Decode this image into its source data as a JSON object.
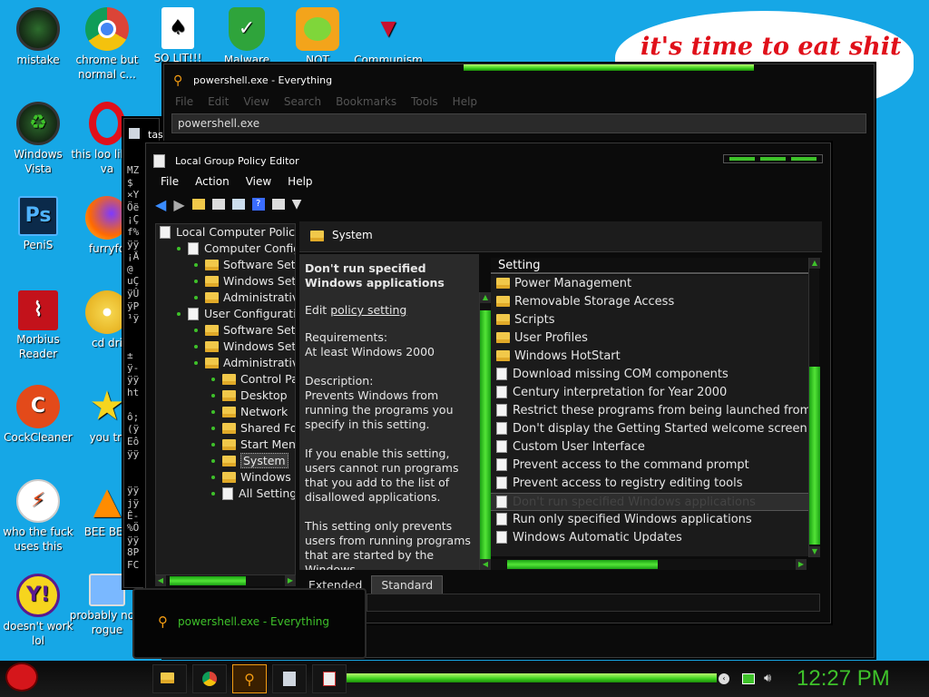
{
  "desktop_icons": [
    {
      "label": "mistake"
    },
    {
      "label": "chrome but normal c..."
    },
    {
      "label": "SO LIT!!!"
    },
    {
      "label": "Malware"
    },
    {
      "label": "NOT"
    },
    {
      "label": "Communism"
    },
    {
      "label": "Windows Vista"
    },
    {
      "label": "this loo like a va"
    },
    {
      "label": "PeniS"
    },
    {
      "label": "furryfo"
    },
    {
      "label": "Morbius Reader"
    },
    {
      "label": "cd dri"
    },
    {
      "label": "CockCleaner"
    },
    {
      "label": "you tri"
    },
    {
      "label": "who the fuck uses this"
    },
    {
      "label": "BEE BEE"
    },
    {
      "label": "doesn't work lol"
    },
    {
      "label": "probably no a rogue"
    }
  ],
  "bubble_text": "it's time to eat shit",
  "everything_window": {
    "title": "powershell.exe - Everything",
    "menu": [
      "File",
      "Edit",
      "View",
      "Search",
      "Bookmarks",
      "Tools",
      "Help"
    ],
    "search_value": "powershell.exe"
  },
  "terminal_window": {
    "title": "tas",
    "text_lines": [
      "MZ",
      "$",
      "×Y",
      "Öë",
      "¡Ç",
      "f%",
      "ÿÿ",
      "¡Ä",
      "@",
      "uÇ",
      "ÿÛ",
      "ÿP",
      "¹ÿ",
      "",
      "",
      "±",
      "ÿ-",
      "ÿÿ",
      "ht",
      "",
      "ô;",
      "(ÿ",
      "Eô",
      "ÿÿ",
      "",
      "",
      "ÿÿ",
      "jÿ",
      "Ê-",
      "%Ö",
      "ÿÿ",
      "8P",
      "FC"
    ]
  },
  "gpe": {
    "title": "Local Group Policy Editor",
    "menu": [
      "File",
      "Action",
      "View",
      "Help"
    ],
    "tree": [
      {
        "label": "Local Computer Policy",
        "indent": 0,
        "icon": "doc"
      },
      {
        "label": "Computer Configura",
        "indent": 1,
        "icon": "pc"
      },
      {
        "label": "Software Setting",
        "indent": 2,
        "icon": "folder"
      },
      {
        "label": "Windows Settin",
        "indent": 2,
        "icon": "folder"
      },
      {
        "label": "Administrative T",
        "indent": 2,
        "icon": "folder"
      },
      {
        "label": "User Configuration",
        "indent": 1,
        "icon": "pc"
      },
      {
        "label": "Software Setting",
        "indent": 2,
        "icon": "folder"
      },
      {
        "label": "Windows Settin",
        "indent": 2,
        "icon": "folder"
      },
      {
        "label": "Administrative T",
        "indent": 2,
        "icon": "folder"
      },
      {
        "label": "Control Pane",
        "indent": 3,
        "icon": "folder"
      },
      {
        "label": "Desktop",
        "indent": 3,
        "icon": "folder"
      },
      {
        "label": "Network",
        "indent": 3,
        "icon": "folder"
      },
      {
        "label": "Shared Fold",
        "indent": 3,
        "icon": "folder"
      },
      {
        "label": "Start Menu a",
        "indent": 3,
        "icon": "folder"
      },
      {
        "label": "System",
        "indent": 3,
        "icon": "folder",
        "selected": true
      },
      {
        "label": "Windows Co",
        "indent": 3,
        "icon": "folder"
      },
      {
        "label": "All Settings",
        "indent": 3,
        "icon": "doc"
      }
    ],
    "pane_header": "System",
    "desc_title": "Don't run specified Windows applications",
    "edit_prefix": "Edit",
    "edit_link": "policy setting",
    "requirements_label": "Requirements:",
    "requirements_value": "At least Windows 2000",
    "description_label": "Description:",
    "description_p1": "Prevents Windows from running the programs you specify in this setting.",
    "description_p2": "If you enable this setting, users cannot run programs that you add to the list of disallowed applications.",
    "description_p3": "This setting only prevents users from running programs that are started by the Windows",
    "settings_header": "Setting",
    "settings": [
      {
        "label": "Power Management",
        "icon": "folder"
      },
      {
        "label": "Removable Storage Access",
        "icon": "folder"
      },
      {
        "label": "Scripts",
        "icon": "folder"
      },
      {
        "label": "User Profiles",
        "icon": "folder"
      },
      {
        "label": "Windows HotStart",
        "icon": "folder"
      },
      {
        "label": "Download missing COM components",
        "icon": "doc"
      },
      {
        "label": "Century interpretation for Year 2000",
        "icon": "doc"
      },
      {
        "label": "Restrict these programs from being launched from Help",
        "icon": "doc"
      },
      {
        "label": "Don't display the Getting Started welcome screen at l...",
        "icon": "doc"
      },
      {
        "label": "Custom User Interface",
        "icon": "doc"
      },
      {
        "label": "Prevent access to the command prompt",
        "icon": "doc"
      },
      {
        "label": "Prevent access to registry editing tools",
        "icon": "doc"
      },
      {
        "label": "Don't run specified Windows applications",
        "icon": "doc",
        "selected": true
      },
      {
        "label": "Run only specified Windows applications",
        "icon": "doc"
      },
      {
        "label": "Windows Automatic Updates",
        "icon": "doc"
      }
    ],
    "tabs": [
      "Extended",
      "Standard"
    ]
  },
  "taskbar_preview": {
    "title": "powershell.exe - Everything"
  },
  "clock": "12:27 PM",
  "colors": {
    "accent": "#3ec12a",
    "desktop": "#16a7e6",
    "bubble_text": "#e0101a"
  }
}
